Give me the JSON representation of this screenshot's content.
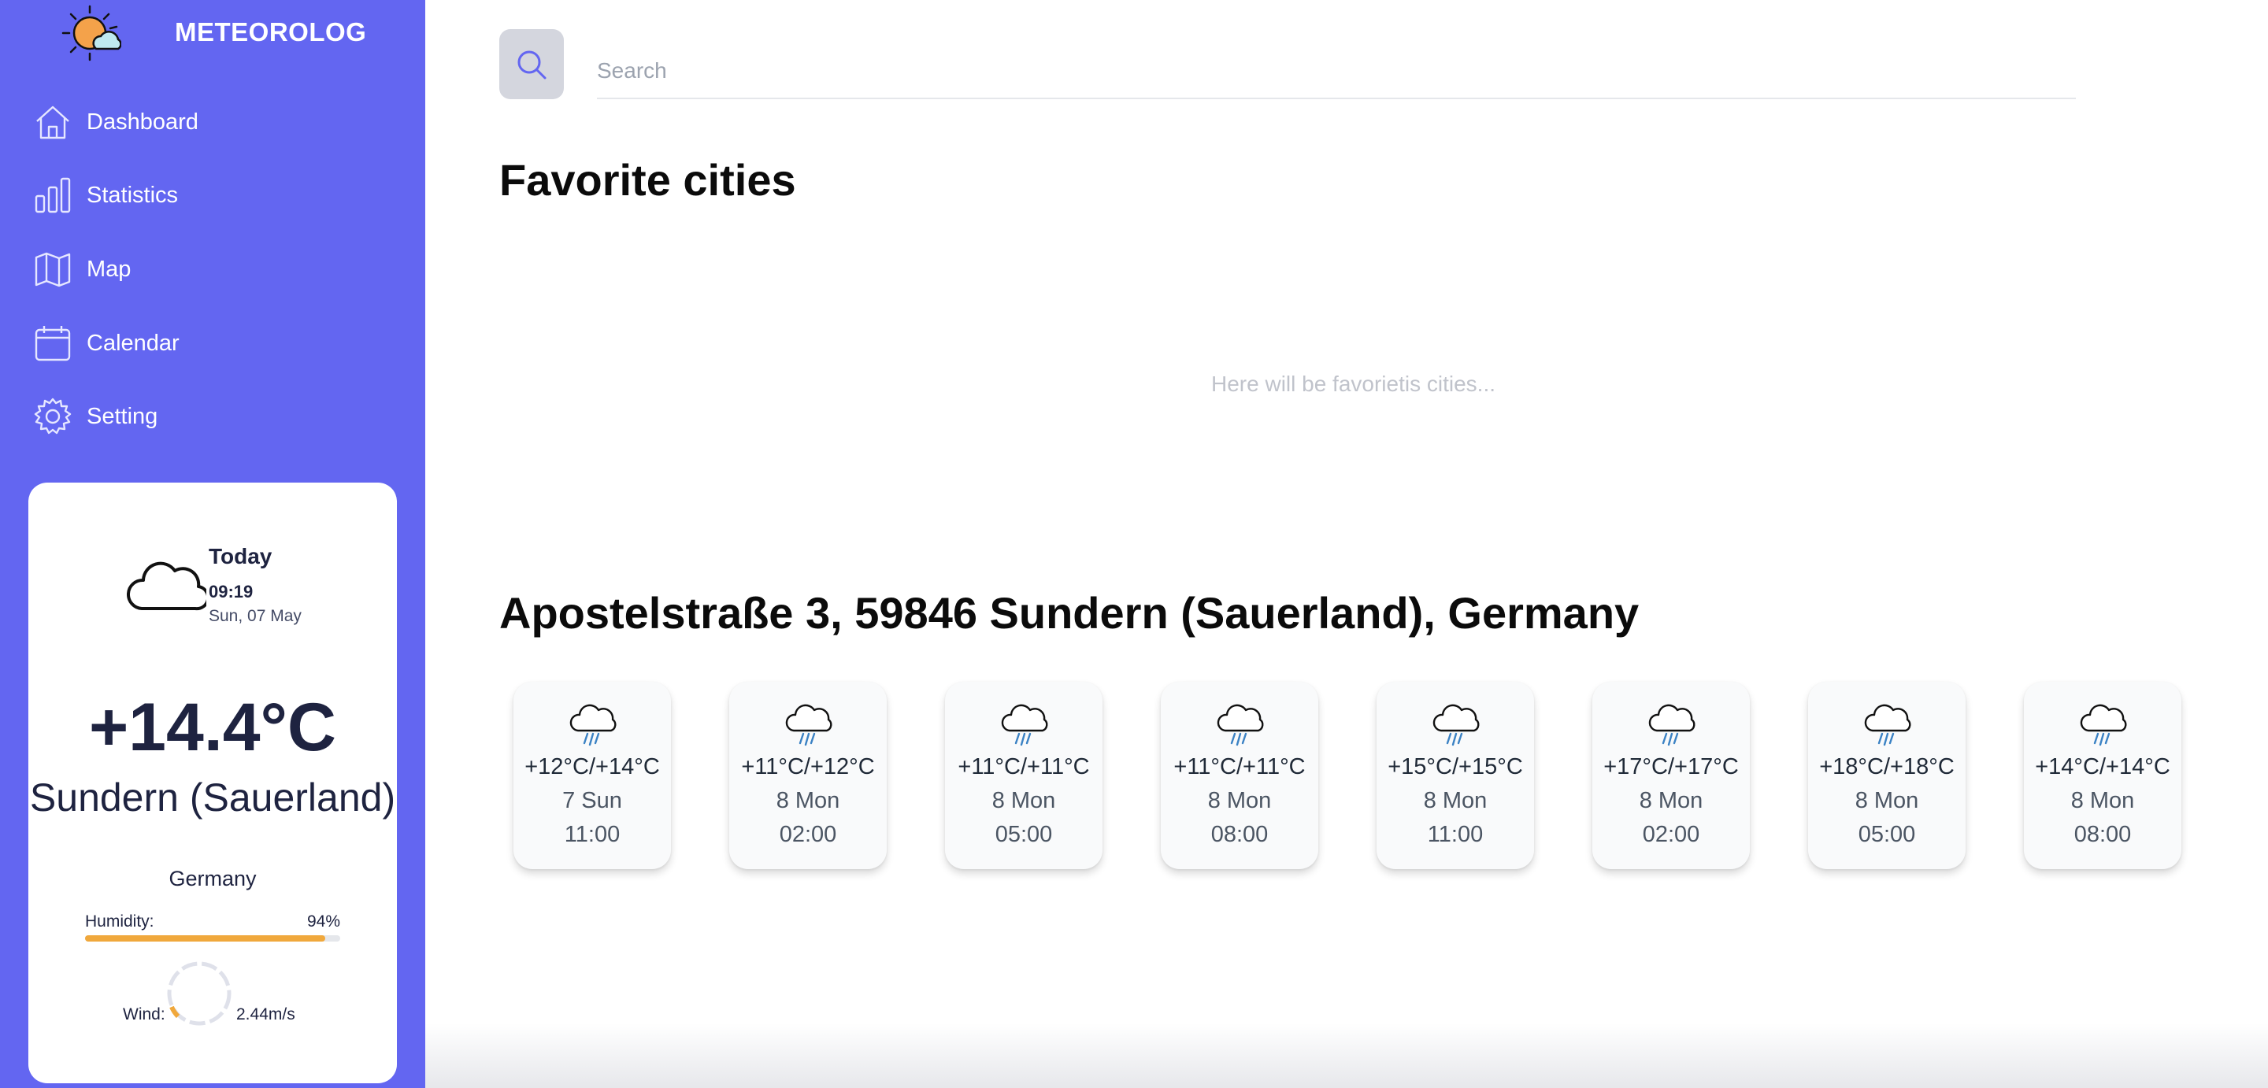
{
  "app": {
    "title": "METEOROLOG",
    "accent_color": "#6366f1",
    "logo_icon": "sun-cloud-icon"
  },
  "sidebar": {
    "items": [
      {
        "label": "Dashboard",
        "icon": "home-icon"
      },
      {
        "label": "Statistics",
        "icon": "bar-chart-icon"
      },
      {
        "label": "Map",
        "icon": "map-icon"
      },
      {
        "label": "Calendar",
        "icon": "calendar-icon"
      },
      {
        "label": "Setting",
        "icon": "gear-icon"
      }
    ]
  },
  "weather_card": {
    "icon": "cloud-icon",
    "today_label": "Today",
    "time": "09:19",
    "date": "Sun, 07 May",
    "temperature": "+14.4°C",
    "city": "Sundern (Sauerland)",
    "country": "Germany",
    "humidity_label": "Humidity:",
    "humidity_value": "94%",
    "humidity_percent": 94,
    "humidity_color": "#f0a83c",
    "wind_label": "Wind:",
    "wind_value": "2.44m/s"
  },
  "search": {
    "placeholder": "Search",
    "value": "",
    "icon": "search-icon"
  },
  "favorites": {
    "title": "Favorite cities",
    "empty_text": "Here will be favorietis cities..."
  },
  "location": {
    "title": "Apostelstraße 3, 59846 Sundern (Sauerland), Germany",
    "forecast": [
      {
        "icon": "rain-cloud-icon",
        "temp": "+12°C/+14°C",
        "day": "7 Sun",
        "time": "11:00"
      },
      {
        "icon": "rain-cloud-icon",
        "temp": "+11°C/+12°C",
        "day": "8 Mon",
        "time": "02:00"
      },
      {
        "icon": "rain-cloud-icon",
        "temp": "+11°C/+11°C",
        "day": "8 Mon",
        "time": "05:00"
      },
      {
        "icon": "rain-cloud-icon",
        "temp": "+11°C/+11°C",
        "day": "8 Mon",
        "time": "08:00"
      },
      {
        "icon": "rain-cloud-icon",
        "temp": "+15°C/+15°C",
        "day": "8 Mon",
        "time": "11:00"
      },
      {
        "icon": "rain-cloud-icon",
        "temp": "+17°C/+17°C",
        "day": "8 Mon",
        "time": "02:00"
      },
      {
        "icon": "rain-cloud-icon",
        "temp": "+18°C/+18°C",
        "day": "8 Mon",
        "time": "05:00"
      },
      {
        "icon": "rain-cloud-icon",
        "temp": "+14°C/+14°C",
        "day": "8 Mon",
        "time": "08:00"
      }
    ]
  }
}
